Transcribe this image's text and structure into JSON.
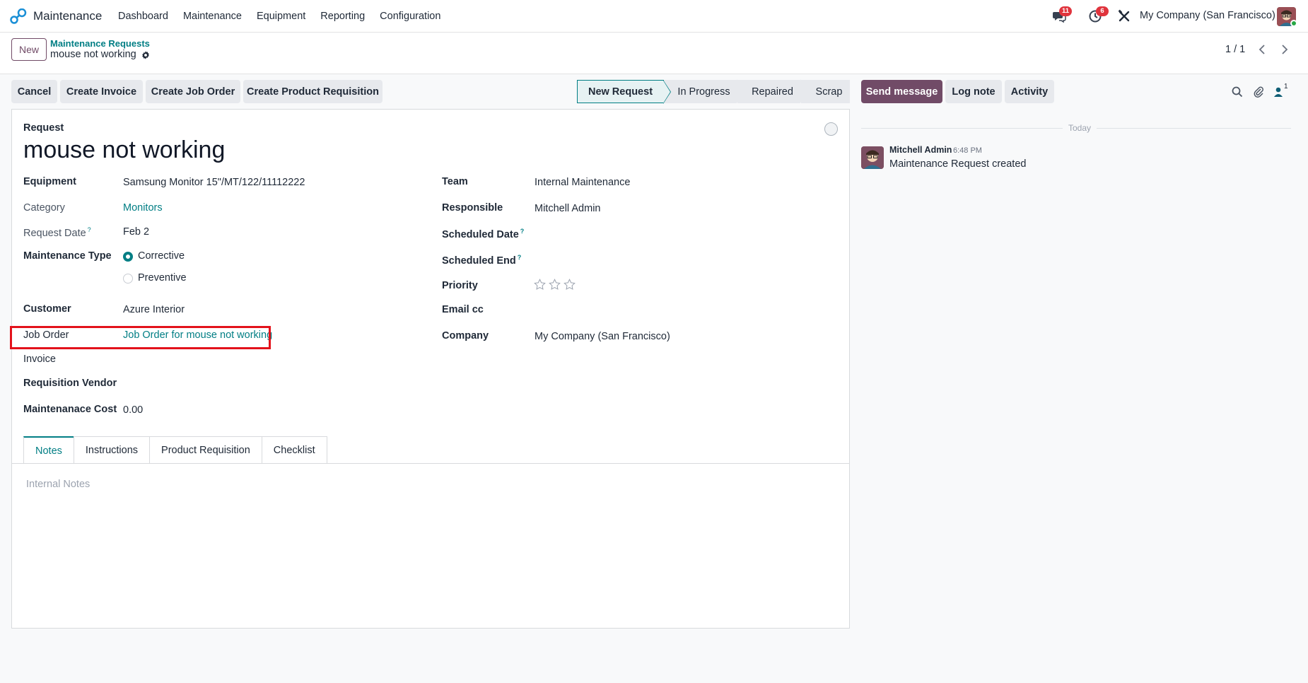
{
  "app": {
    "name": "Maintenance"
  },
  "menu": [
    "Dashboard",
    "Maintenance",
    "Equipment",
    "Reporting",
    "Configuration"
  ],
  "systray": {
    "messages_count": "11",
    "activities_count": "6",
    "company": "My Company (San Francisco)"
  },
  "control": {
    "new_label": "New",
    "breadcrumb": "Maintenance Requests",
    "record_name": "mouse not working",
    "pager": "1 / 1"
  },
  "actions": [
    "Cancel",
    "Create Invoice",
    "Create Job Order",
    "Create Product Requisition"
  ],
  "stages": [
    "New Request",
    "In Progress",
    "Repaired",
    "Scrap"
  ],
  "chatter_buttons": {
    "send": "Send message",
    "log": "Log note",
    "activity": "Activity",
    "followers_count": "1"
  },
  "form": {
    "section_label": "Request",
    "title": "mouse not working",
    "left": {
      "equipment": {
        "label": "Equipment",
        "value": "Samsung Monitor 15\"/MT/122/11112222"
      },
      "category": {
        "label": "Category",
        "value": "Monitors"
      },
      "request_date": {
        "label": "Request Date",
        "help": "?",
        "value": "Feb 2"
      },
      "maintenance_type": {
        "label": "Maintenance Type",
        "options": [
          "Corrective",
          "Preventive"
        ],
        "selected": "Corrective"
      },
      "customer": {
        "label": "Customer",
        "value": "Azure Interior"
      },
      "job_order": {
        "label": "Job Order",
        "value": "Job Order for mouse not working"
      },
      "invoice": {
        "label": "Invoice",
        "value": ""
      },
      "requisition_vendor": {
        "label": "Requisition Vendor",
        "value": ""
      },
      "cost": {
        "label": "Maintenanace Cost",
        "value": "0.00"
      }
    },
    "right": {
      "team": {
        "label": "Team",
        "value": "Internal Maintenance"
      },
      "responsible": {
        "label": "Responsible",
        "value": "Mitchell Admin"
      },
      "scheduled_date": {
        "label": "Scheduled Date",
        "help": "?",
        "value": ""
      },
      "scheduled_end": {
        "label": "Scheduled End",
        "help": "?",
        "value": ""
      },
      "priority": {
        "label": "Priority",
        "stars_filled": 0,
        "stars_total": 3
      },
      "email_cc": {
        "label": "Email cc",
        "value": ""
      },
      "company": {
        "label": "Company",
        "value": "My Company (San Francisco)"
      }
    },
    "tabs": [
      "Notes",
      "Instructions",
      "Product Requisition",
      "Checklist"
    ],
    "active_tab": "Notes",
    "notes_placeholder": "Internal Notes"
  },
  "chatter": {
    "date_separator": "Today",
    "messages": [
      {
        "author": "Mitchell Admin",
        "time": "6:48 PM",
        "body": "Maintenance Request created"
      }
    ]
  },
  "colors": {
    "primary": "#714b67",
    "accent": "#017e84",
    "highlight": "#e3121b",
    "badge": "#e0343d"
  }
}
